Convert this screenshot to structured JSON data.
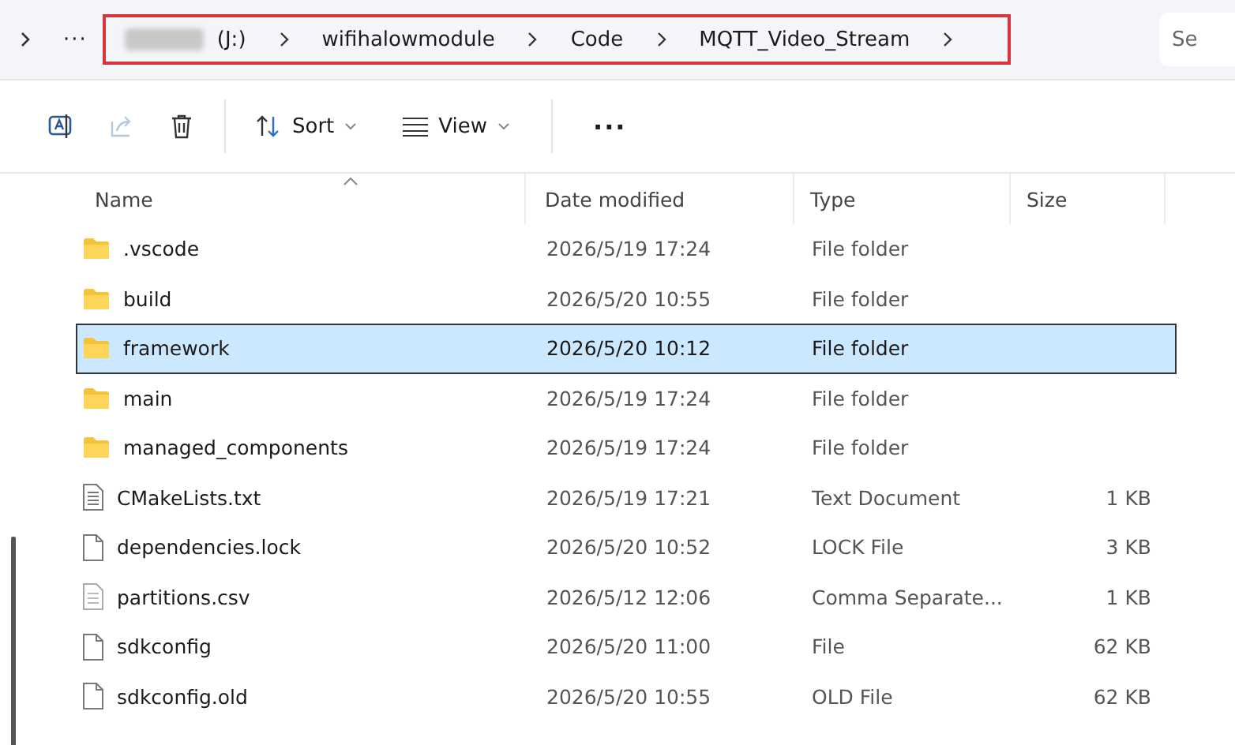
{
  "breadcrumb": {
    "segments": [
      "(J:)",
      "wifihalowmodule",
      "Code",
      "MQTT_Video_Stream"
    ],
    "ellipsis": "···",
    "highlighted": true
  },
  "search": {
    "placeholder": "Se"
  },
  "toolbar": {
    "sort": "Sort",
    "view": "View",
    "more": "···"
  },
  "table": {
    "columns": [
      "Name",
      "Date modified",
      "Type",
      "Size"
    ],
    "rows": [
      {
        "kind": "folder",
        "name": ".vscode",
        "date": "2026/5/19 17:24",
        "type": "File folder",
        "size": "",
        "selected": false
      },
      {
        "kind": "folder",
        "name": "build",
        "date": "2026/5/20 10:55",
        "type": "File folder",
        "size": "",
        "selected": false
      },
      {
        "kind": "folder",
        "name": "framework",
        "date": "2026/5/20 10:12",
        "type": "File folder",
        "size": "",
        "selected": true
      },
      {
        "kind": "folder",
        "name": "main",
        "date": "2026/5/19 17:24",
        "type": "File folder",
        "size": "",
        "selected": false
      },
      {
        "kind": "folder",
        "name": "managed_components",
        "date": "2026/5/19 17:24",
        "type": "File folder",
        "size": "",
        "selected": false
      },
      {
        "kind": "text",
        "name": "CMakeLists.txt",
        "date": "2026/5/19 17:21",
        "type": "Text Document",
        "size": "1 KB",
        "selected": false
      },
      {
        "kind": "file",
        "name": "dependencies.lock",
        "date": "2026/5/20 10:52",
        "type": "LOCK File",
        "size": "3 KB",
        "selected": false
      },
      {
        "kind": "csv",
        "name": "partitions.csv",
        "date": "2026/5/12 12:06",
        "type": "Comma Separate...",
        "size": "1 KB",
        "selected": false
      },
      {
        "kind": "file",
        "name": "sdkconfig",
        "date": "2026/5/20 11:00",
        "type": "File",
        "size": "62 KB",
        "selected": false
      },
      {
        "kind": "file",
        "name": "sdkconfig.old",
        "date": "2026/5/20 10:55",
        "type": "OLD File",
        "size": "62 KB",
        "selected": false
      }
    ]
  }
}
